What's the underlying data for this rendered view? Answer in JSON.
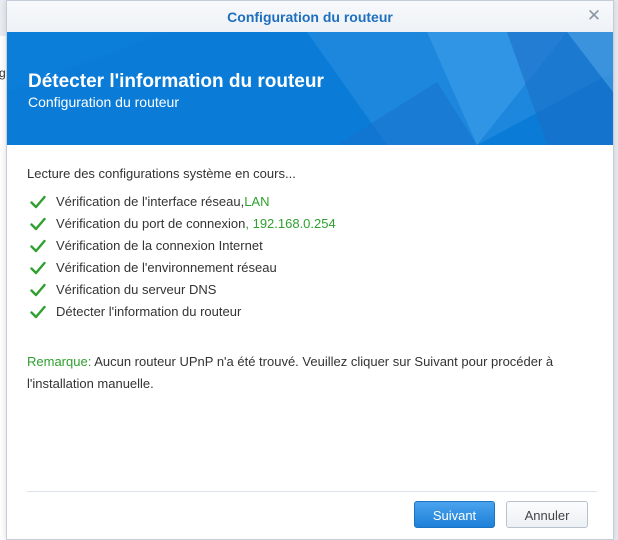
{
  "background_app": {
    "partial_char": "g"
  },
  "window": {
    "title": "Configuration du routeur",
    "close_icon": "close-icon"
  },
  "banner": {
    "title": "Détecter l'information du routeur",
    "subtitle": "Configuration du routeur",
    "color": "#0a7cd8"
  },
  "content": {
    "intro": "Lecture des configurations système en cours...",
    "checks": [
      {
        "text": "Vérification de l'interface réseau, ",
        "value": "LAN",
        "status": "check-icon"
      },
      {
        "text": "Vérification du port de connexion ",
        "value": ", 192.168.0.254",
        "status": "check-icon"
      },
      {
        "text": "Vérification de la connexion Internet",
        "value": "",
        "status": "check-icon"
      },
      {
        "text": "Vérification de l'environnement réseau",
        "value": "",
        "status": "check-icon"
      },
      {
        "text": "Vérification du serveur DNS",
        "value": "",
        "status": "check-icon"
      },
      {
        "text": "Détecter l'information du routeur",
        "value": "",
        "status": "check-icon"
      }
    ],
    "remark_label": "Remarque:",
    "remark_text": " Aucun routeur UPnP n'a été trouvé. Veuillez cliquer sur Suivant pour procéder à l'installation manuelle."
  },
  "buttons": {
    "next_label": "Suivant",
    "cancel_label": "Annuler"
  },
  "colors": {
    "accent_green": "#2fa02f",
    "title_blue": "#1f6fbf",
    "primary_button": "#1d80d8"
  }
}
